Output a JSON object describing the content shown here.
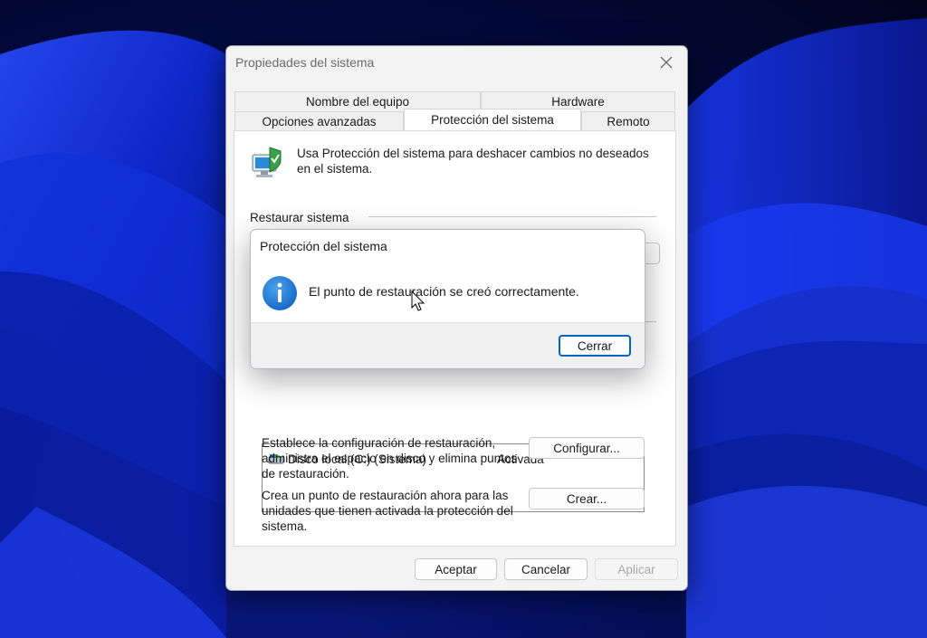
{
  "window": {
    "title": "Propiedades del sistema"
  },
  "tabs": [
    {
      "label": "Nombre del equipo"
    },
    {
      "label": "Hardware"
    },
    {
      "label": "Opciones avanzadas"
    },
    {
      "label": "Protección del sistema",
      "active": true
    },
    {
      "label": "Remoto"
    }
  ],
  "protection": {
    "intro": "Usa Protección del sistema para deshacer cambios no deseados en el sistema.",
    "restore_group_label": "Restaurar sistema",
    "drives": [
      {
        "name": "Disco local (C:) (Sistema)",
        "status": "Activada"
      }
    ],
    "configure_text": "Establece la configuración de restauración, administra el espacio en disco y elimina puntos de restauración.",
    "configure_button": "Configurar...",
    "create_text": "Crea un punto de restauración ahora para las unidades que tienen activada la protección del sistema.",
    "create_button": "Crear..."
  },
  "footer": {
    "ok": "Aceptar",
    "cancel": "Cancelar",
    "apply": "Aplicar"
  },
  "dialog": {
    "title": "Protección del sistema",
    "message": "El punto de restauración se creó correctamente.",
    "close_button": "Cerrar"
  },
  "icons": {
    "window_close": "close-icon",
    "system_protection": "system-protection-icon",
    "drive": "drive-icon",
    "info": "info-icon"
  },
  "colors": {
    "accent": "#0067c0",
    "info_icon": "#1e7bd6",
    "wallpaper": "#0a1a8a"
  }
}
